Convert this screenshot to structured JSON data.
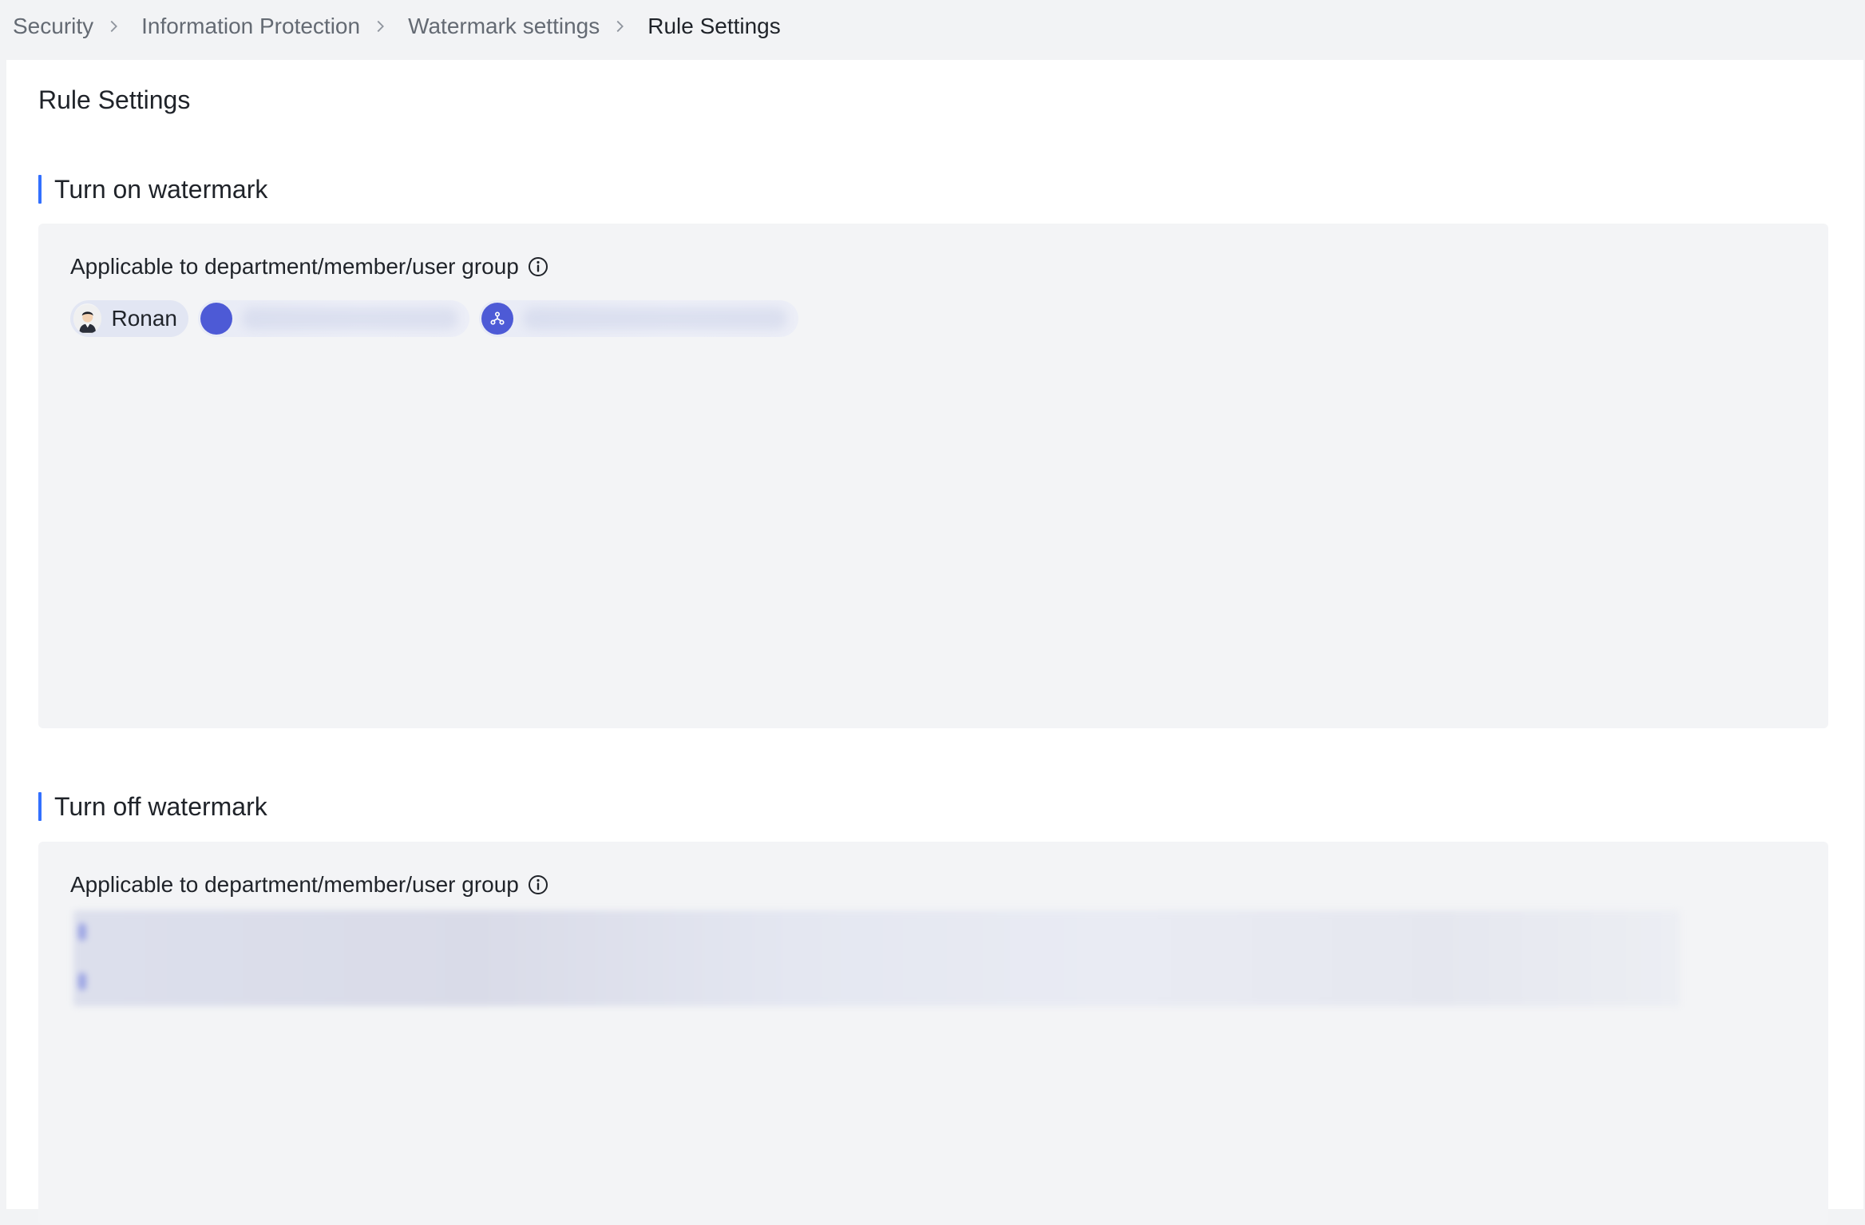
{
  "breadcrumb": {
    "items": [
      "Security",
      "Information Protection",
      "Watermark settings",
      "Rule Settings"
    ]
  },
  "page": {
    "title": "Rule Settings"
  },
  "turn_on": {
    "section_title": "Turn on watermark",
    "field_label": "Applicable to department/member/user group",
    "tags": [
      {
        "type": "member",
        "label": "Ronan"
      }
    ]
  },
  "turn_off": {
    "section_title": "Turn off watermark",
    "field_label": "Applicable to department/member/user group"
  },
  "colors": {
    "accent": "#3370ff",
    "tag_bg": "#e2e6f3",
    "dept_icon_bg": "#4d5ad6",
    "card_bg": "#f3f4f6"
  },
  "icons": {
    "breadcrumb_separator": "chevron-right-icon",
    "info": "info-circle-icon",
    "department": "org-chart-icon"
  }
}
